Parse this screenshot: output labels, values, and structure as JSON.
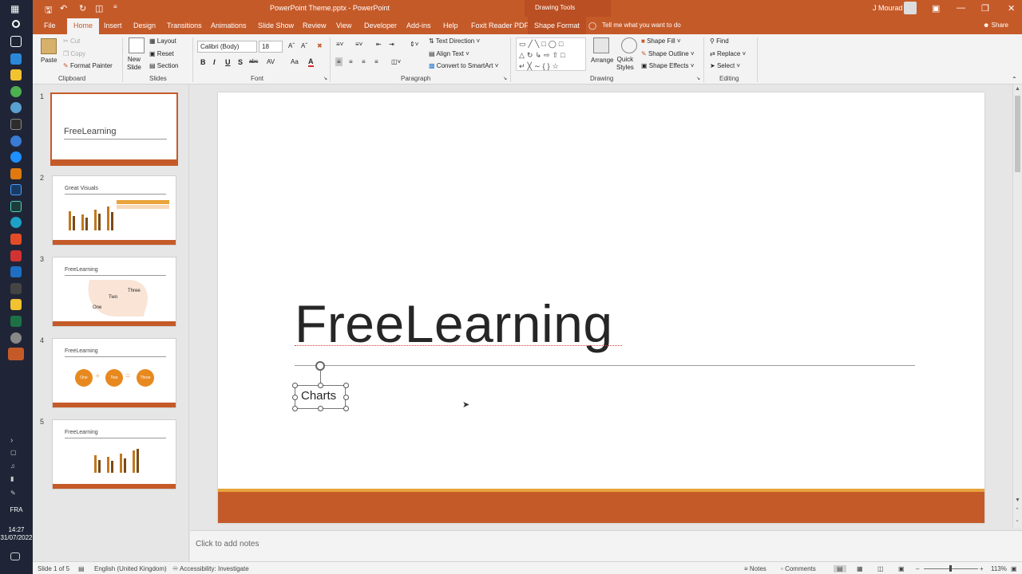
{
  "app": {
    "title": "PowerPoint Theme.pptx - PowerPoint",
    "context_tab_group": "Drawing Tools",
    "user": "J Mourad",
    "tell_me": "Tell me what you want to do",
    "share": "Share",
    "accent": "#c55a29"
  },
  "tabs": [
    "File",
    "Home",
    "Insert",
    "Design",
    "Transitions",
    "Animations",
    "Slide Show",
    "Review",
    "View",
    "Developer",
    "Add-ins",
    "Help",
    "Foxit Reader PDF",
    "Shape Format"
  ],
  "active_tab": "Home",
  "ribbon": {
    "clipboard": {
      "paste": "Paste",
      "cut": "Cut",
      "copy": "Copy",
      "format_painter": "Format Painter",
      "label": "Clipboard"
    },
    "slides": {
      "new_slide": "New",
      "new_slide2": "Slide",
      "layout": "Layout",
      "reset": "Reset",
      "section": "Section",
      "label": "Slides"
    },
    "font": {
      "family": "Calibri (Body)",
      "size": "18",
      "bold": "B",
      "italic": "I",
      "underline": "U",
      "shadow": "S",
      "strike": "abc",
      "spacing": "AV",
      "case": "Aa",
      "color": "A",
      "label": "Font"
    },
    "paragraph": {
      "text_direction": "Text Direction",
      "align_text": "Align Text",
      "convert_smartart": "Convert to SmartArt",
      "label": "Paragraph"
    },
    "drawing": {
      "arrange": "Arrange",
      "quick_styles": "Quick",
      "quick_styles2": "Styles",
      "shape_fill": "Shape Fill",
      "shape_outline": "Shape Outline",
      "shape_effects": "Shape Effects",
      "label": "Drawing"
    },
    "editing": {
      "find": "Find",
      "replace": "Replace",
      "select": "Select",
      "label": "Editing"
    }
  },
  "thumbnails": [
    {
      "num": "1",
      "title": "FreeLearning",
      "selected": true
    },
    {
      "num": "2",
      "title": "Great Visuals"
    },
    {
      "num": "3",
      "title": "FreeLearning",
      "labels": [
        "One",
        "Two",
        "Three"
      ]
    },
    {
      "num": "4",
      "title": "FreeLearning",
      "labels": [
        "One",
        "Two",
        "Three"
      ]
    },
    {
      "num": "5",
      "title": "FreeLearning"
    }
  ],
  "slide": {
    "title": "FreeLearning",
    "subtitle": "Charts"
  },
  "notes": {
    "placeholder": "Click to add notes"
  },
  "status": {
    "slide": "Slide 1 of 5",
    "language": "English (United Kingdom)",
    "accessibility": "Accessibility: Investigate",
    "notes": "Notes",
    "comments": "Comments",
    "zoom": "113%"
  },
  "taskbar": {
    "lang": "FRA",
    "time": "14:27",
    "date": "31/07/2022"
  }
}
